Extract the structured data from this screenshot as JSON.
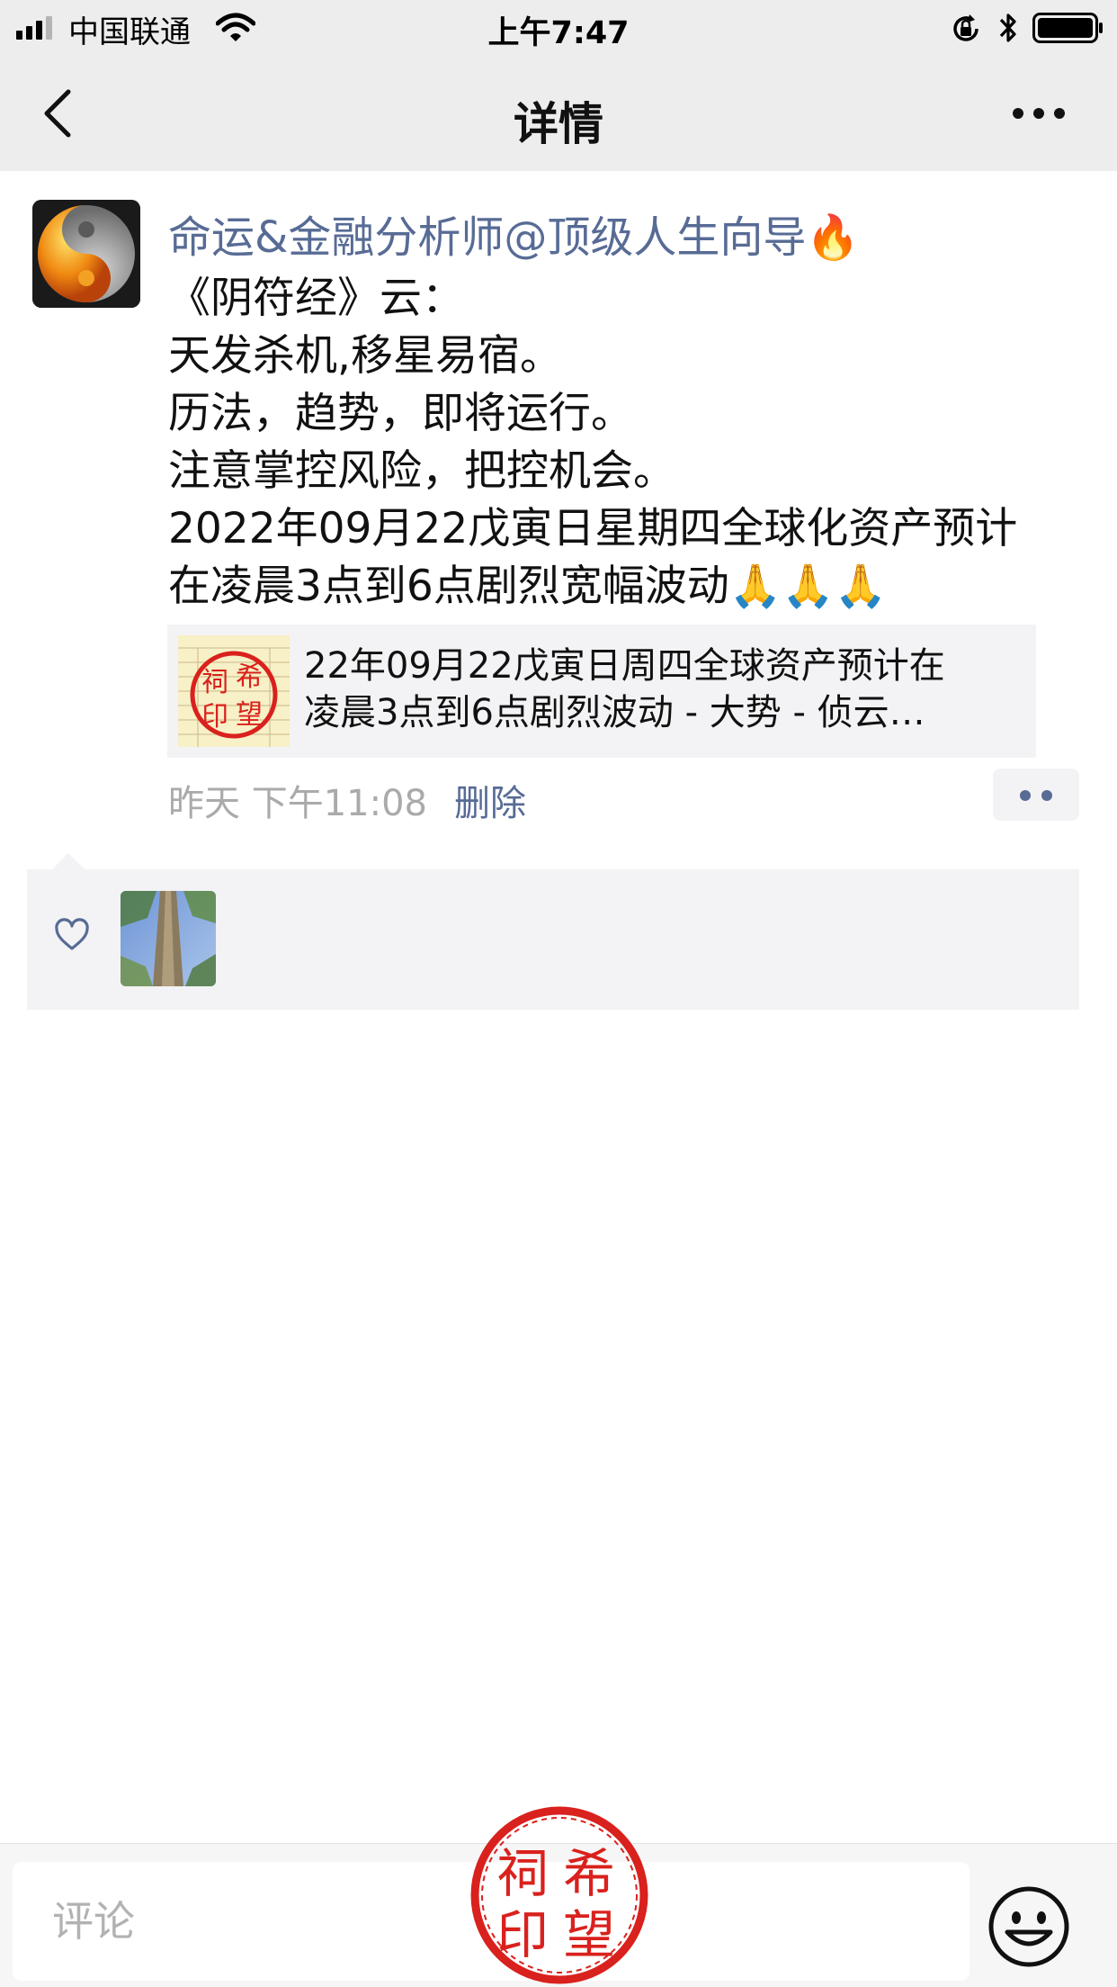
{
  "status_bar": {
    "carrier": "中国联通",
    "time": "上午7:47",
    "icons": [
      "signal-bars-icon",
      "wifi-icon",
      "rotation-lock-icon",
      "bluetooth-icon",
      "battery-icon"
    ]
  },
  "nav": {
    "title": "详情",
    "back_icon": "chevron-left-icon",
    "more_icon": "more-dots-icon"
  },
  "post": {
    "author": "命运&金融分析师@顶级人生向导🔥",
    "lines": [
      "《阴符经》云：",
      "天发杀机,移星易宿。",
      "历法，趋势，即将运行。",
      "注意掌控风险，把控机会。",
      "2022年09月22戊寅日星期四全球化资产预计",
      "在凌晨3点到6点剧烈宽幅波动🙏🙏🙏"
    ],
    "link_card": {
      "title_line1": "22年09月22戊寅日周四全球资产预计在",
      "title_line2": "凌晨3点到6点剧烈波动 - 大势 - 侦云…"
    },
    "time": "昨天 下午11:08",
    "delete_label": "删除"
  },
  "likes": {
    "icon": "heart-outline-icon"
  },
  "comment_bar": {
    "placeholder": "评论",
    "emoji_icon": "smiley-face-icon"
  },
  "seal": {
    "text": "祠希印望"
  },
  "colors": {
    "link_blue": "#576b95",
    "bar_gray": "#ededed",
    "card_gray": "#f3f3f5",
    "seal_red": "#d9211d"
  }
}
